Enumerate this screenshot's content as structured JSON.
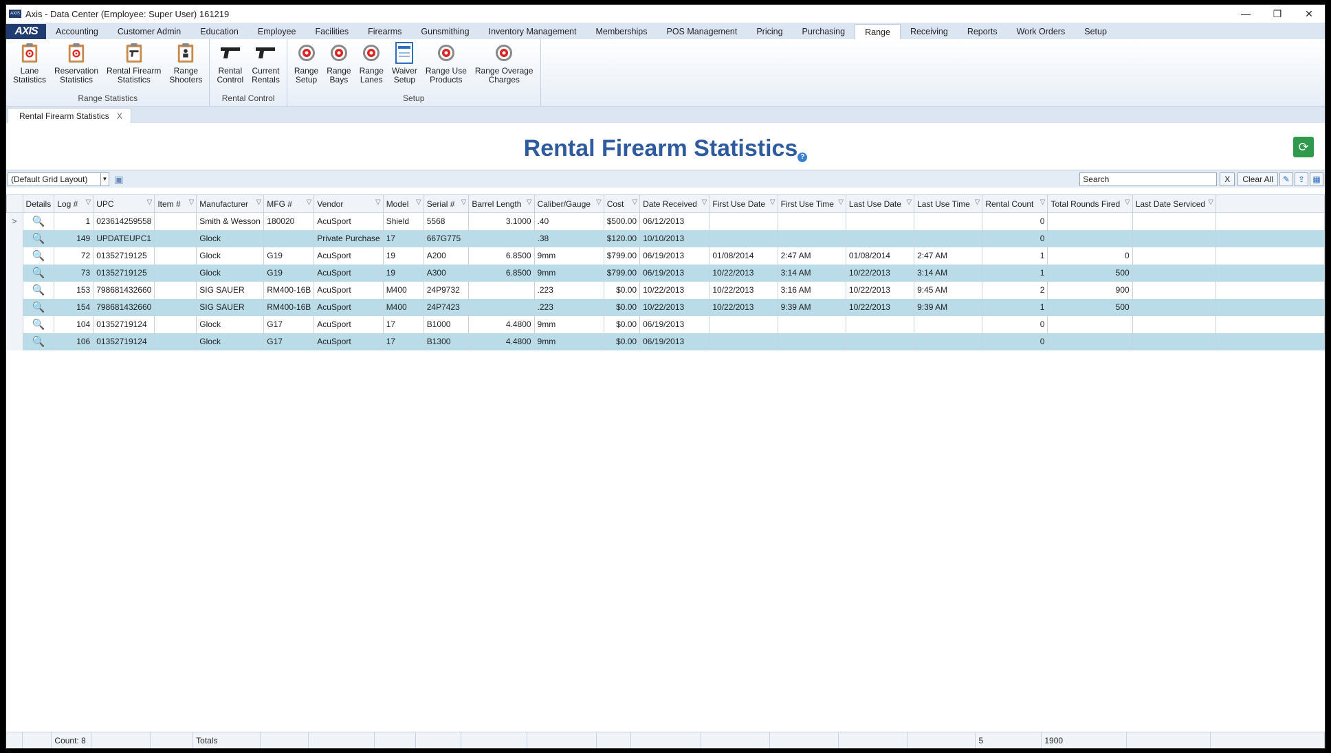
{
  "window": {
    "title": "Axis - Data Center  (Employee: Super User) 161219",
    "minimize": "—",
    "restore": "❐",
    "close": "✕"
  },
  "logo": "AXIS",
  "menu": [
    "Accounting",
    "Customer Admin",
    "Education",
    "Employee",
    "Facilities",
    "Firearms",
    "Gunsmithing",
    "Inventory Management",
    "Memberships",
    "POS Management",
    "Pricing",
    "Purchasing",
    "Range",
    "Receiving",
    "Reports",
    "Work Orders",
    "Setup"
  ],
  "menu_active": "Range",
  "ribbon": {
    "groups": [
      {
        "label": "Range Statistics",
        "items": [
          {
            "line1": "Lane",
            "line2": "Statistics",
            "icon": "clipboard-target-icon"
          },
          {
            "line1": "Reservation",
            "line2": "Statistics",
            "icon": "clipboard-target-icon"
          },
          {
            "line1": "Rental Firearm",
            "line2": "Statistics",
            "icon": "clipboard-gun-icon"
          },
          {
            "line1": "Range",
            "line2": "Shooters",
            "icon": "clipboard-person-icon"
          }
        ]
      },
      {
        "label": "Rental Control",
        "items": [
          {
            "line1": "Rental",
            "line2": "Control",
            "icon": "pistol-icon"
          },
          {
            "line1": "Current",
            "line2": "Rentals",
            "icon": "pistol-icon"
          }
        ]
      },
      {
        "label": "Setup",
        "items": [
          {
            "line1": "Range",
            "line2": "Setup",
            "icon": "target-gear-icon"
          },
          {
            "line1": "Range",
            "line2": "Bays",
            "icon": "target-gear-icon"
          },
          {
            "line1": "Range",
            "line2": "Lanes",
            "icon": "target-gear-icon"
          },
          {
            "line1": "Waiver",
            "line2": "Setup",
            "icon": "waiver-document-icon"
          },
          {
            "line1": "Range Use",
            "line2": "Products",
            "icon": "target-gear-icon"
          },
          {
            "line1": "Range Overage",
            "line2": "Charges",
            "icon": "target-gear-icon"
          }
        ]
      }
    ]
  },
  "doc_tab": {
    "label": "Rental Firearm Statistics",
    "close": "X"
  },
  "page_title": "Rental Firearm Statistics",
  "help": "?",
  "toolbar": {
    "layout": "(Default Grid Layout)",
    "search_placeholder": "Search",
    "clear_x": "X",
    "clear_all": "Clear All"
  },
  "grid": {
    "columns": [
      "Details",
      "Log #",
      "UPC",
      "Item #",
      "Manufacturer",
      "MFG #",
      "Vendor",
      "Model",
      "Serial #",
      "Barrel Length",
      "Caliber/Gauge",
      "Cost",
      "Date Received",
      "First Use Date",
      "First Use Time",
      "Last Use Date",
      "Last Use Time",
      "Rental Count",
      "Total Rounds Fired",
      "Last Date Serviced"
    ],
    "rows": [
      [
        "",
        "1",
        "023614259558",
        "",
        "Smith & Wesson",
        "180020",
        "AcuSport",
        "Shield",
        "5568",
        "3.1000",
        ".40",
        "$500.00",
        "06/12/2013",
        "",
        "",
        "",
        "",
        "0",
        "",
        ""
      ],
      [
        "",
        "149",
        "UPDATEUPC1",
        "",
        "Glock",
        "",
        "Private Purchase",
        "17",
        "667G775",
        "",
        ".38",
        "$120.00",
        "10/10/2013",
        "",
        "",
        "",
        "",
        "0",
        "",
        ""
      ],
      [
        "",
        "72",
        "01352719125",
        "",
        "Glock",
        "G19",
        "AcuSport",
        "19",
        "A200",
        "6.8500",
        "9mm",
        "$799.00",
        "06/19/2013",
        "01/08/2014",
        "2:47 AM",
        "01/08/2014",
        "2:47 AM",
        "1",
        "0",
        ""
      ],
      [
        "",
        "73",
        "01352719125",
        "",
        "Glock",
        "G19",
        "AcuSport",
        "19",
        "A300",
        "6.8500",
        "9mm",
        "$799.00",
        "06/19/2013",
        "10/22/2013",
        "3:14 AM",
        "10/22/2013",
        "3:14 AM",
        "1",
        "500",
        ""
      ],
      [
        "",
        "153",
        "798681432660",
        "",
        "SIG SAUER",
        "RM400-16B",
        "AcuSport",
        "M400",
        "24P9732",
        "",
        ".223",
        "$0.00",
        "10/22/2013",
        "10/22/2013",
        "3:16 AM",
        "10/22/2013",
        "9:45 AM",
        "2",
        "900",
        ""
      ],
      [
        "",
        "154",
        "798681432660",
        "",
        "SIG SAUER",
        "RM400-16B",
        "AcuSport",
        "M400",
        "24P7423",
        "",
        ".223",
        "$0.00",
        "10/22/2013",
        "10/22/2013",
        "9:39 AM",
        "10/22/2013",
        "9:39 AM",
        "1",
        "500",
        ""
      ],
      [
        "",
        "104",
        "01352719124",
        "",
        "Glock",
        "G17",
        "AcuSport",
        "17",
        "B1000",
        "4.4800",
        "9mm",
        "$0.00",
        "06/19/2013",
        "",
        "",
        "",
        "",
        "0",
        "",
        ""
      ],
      [
        "",
        "106",
        "01352719124",
        "",
        "Glock",
        "G17",
        "AcuSport",
        "17",
        "B1300",
        "4.4800",
        "9mm",
        "$0.00",
        "06/19/2013",
        "",
        "",
        "",
        "",
        "0",
        "",
        ""
      ]
    ],
    "current_row_marker": ">",
    "footer": {
      "count": "Count: 8",
      "totals_label": "Totals",
      "rental_count_total": "5",
      "rounds_total": "1900"
    }
  }
}
